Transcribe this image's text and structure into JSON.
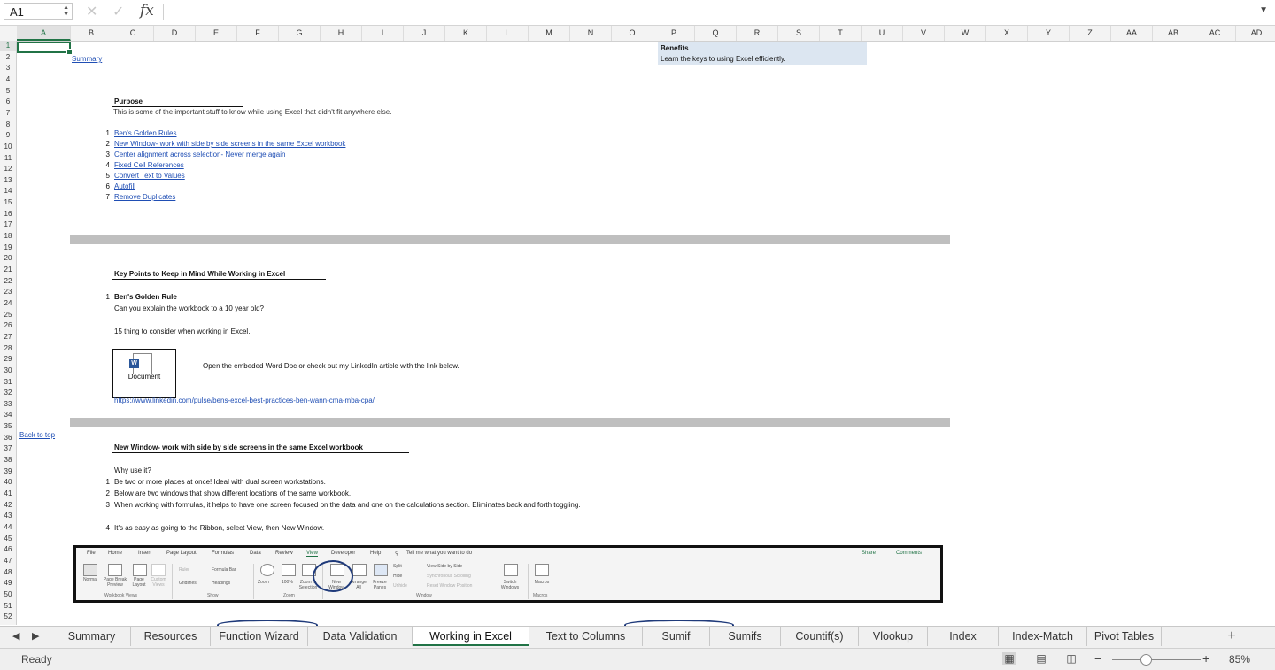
{
  "formula_bar": {
    "name_box": "A1",
    "fx_label": "fx",
    "formula": ""
  },
  "columns": [
    "A",
    "B",
    "C",
    "D",
    "E",
    "F",
    "G",
    "H",
    "I",
    "J",
    "K",
    "L",
    "M",
    "N",
    "O",
    "P",
    "Q",
    "R",
    "S",
    "T",
    "U",
    "V",
    "W",
    "X",
    "Y",
    "Z",
    "AA",
    "AB",
    "AC",
    "AD"
  ],
  "rows": [
    "1",
    "2",
    "3",
    "4",
    "5",
    "6",
    "7",
    "8",
    "9",
    "10",
    "11",
    "12",
    "13",
    "14",
    "15",
    "16",
    "17",
    "18",
    "19",
    "20",
    "21",
    "22",
    "23",
    "24",
    "25",
    "26",
    "27",
    "28",
    "29",
    "30",
    "31",
    "32",
    "33",
    "34",
    "35",
    "36",
    "37",
    "38",
    "39",
    "40",
    "41",
    "42",
    "43",
    "44",
    "45",
    "46",
    "47",
    "48",
    "49",
    "50",
    "51",
    "52"
  ],
  "cells": {
    "summary_link": "Summary",
    "benefits_title": "Benefits",
    "benefits_text": "Learn the keys to using Excel efficiently.",
    "purpose_title": "Purpose",
    "purpose_text": "This is some of the important stuff to know while using Excel that didn't fit anywhere else.",
    "toc": [
      {
        "num": "1",
        "label": "Ben's Golden Rules"
      },
      {
        "num": "2",
        "label": "New Window- work with side by side screens in the same Excel workbook"
      },
      {
        "num": "3",
        "label": "Center alignment across selection- Never merge again"
      },
      {
        "num": "4",
        "label": "Fixed Cell References"
      },
      {
        "num": "5",
        "label": "Convert Text to Values"
      },
      {
        "num": "6",
        "label": "Autofill"
      },
      {
        "num": "7",
        "label": "Remove Duplicates"
      }
    ],
    "key_points_title": "Key Points to Keep in Mind While Working in Excel",
    "golden_num": "1",
    "golden_title": "Ben's Golden Rule",
    "golden_q": "Can you explain the workbook to a 10 year old?",
    "fifteen": "15 thing to consider when working in Excel.",
    "doc_label": "Document",
    "embed_text": "Open the embeded Word Doc or check out my LinkedIn article with the link below.",
    "linkedin_url": "https://www.linkedin.com/pulse/bens-excel-best-practices-ben-wann-cma-mba-cpa/",
    "back_to_top": "Back to top",
    "new_window_title": "New Window- work with side by side screens in the same Excel workbook",
    "why": "Why use it?",
    "reasons": [
      {
        "num": "1",
        "text": "Be two or more places at once! Ideal with dual screen workstations."
      },
      {
        "num": "2",
        "text": "Below are two windows that show different locations of the same workbook."
      },
      {
        "num": "3",
        "text": "When working with formulas, it helps to have one screen focused on the data and one on the calculations section. Eliminates back and forth toggling."
      }
    ],
    "step4_num": "4",
    "step4_text": "It's as easy as going to the Ribbon, select View, then New Window."
  },
  "ribbon_image": {
    "tabs": [
      "File",
      "Home",
      "Insert",
      "Page Layout",
      "Formulas",
      "Data",
      "Review",
      "View",
      "Developer",
      "Help"
    ],
    "tell_me": "Tell me what you want to do",
    "share": "Share",
    "comments": "Comments",
    "buttons": {
      "normal": "Normal",
      "page_break": "Page Break Preview",
      "page_layout": "Page Layout",
      "custom_views": "Custom Views",
      "ruler": "Ruler",
      "formula_bar": "Formula Bar",
      "gridlines": "Gridlines",
      "headings": "Headings",
      "zoom": "Zoom",
      "hundred": "100%",
      "zoom_sel": "Zoom to Selection",
      "new_window": "New Window",
      "arrange_all": "Arrange All",
      "freeze": "Freeze Panes",
      "split": "Split",
      "hide": "Hide",
      "unhide": "Unhide",
      "side_by_side": "View Side by Side",
      "sync_scroll": "Synchronous Scrolling",
      "reset_pos": "Reset Window Position",
      "switch": "Switch Windows",
      "macros": "Macros"
    },
    "groups": [
      "Workbook Views",
      "Show",
      "Zoom",
      "Window",
      "Macros"
    ]
  },
  "sheet_tabs": [
    "Summary",
    "Resources",
    "Function Wizard",
    "Data Validation",
    "Working in Excel",
    "Text to Columns",
    "Sumif",
    "Sumifs",
    "Countif(s)",
    "Vlookup",
    "Index",
    "Index-Match",
    "Pivot Tables"
  ],
  "active_sheet": "Working in Excel",
  "status": {
    "ready": "Ready",
    "zoom": "85%"
  },
  "colors": {
    "accent": "#217346",
    "link": "#1f4eb4",
    "benefits_fill": "#dce6f1",
    "band": "#bfbfbf"
  }
}
